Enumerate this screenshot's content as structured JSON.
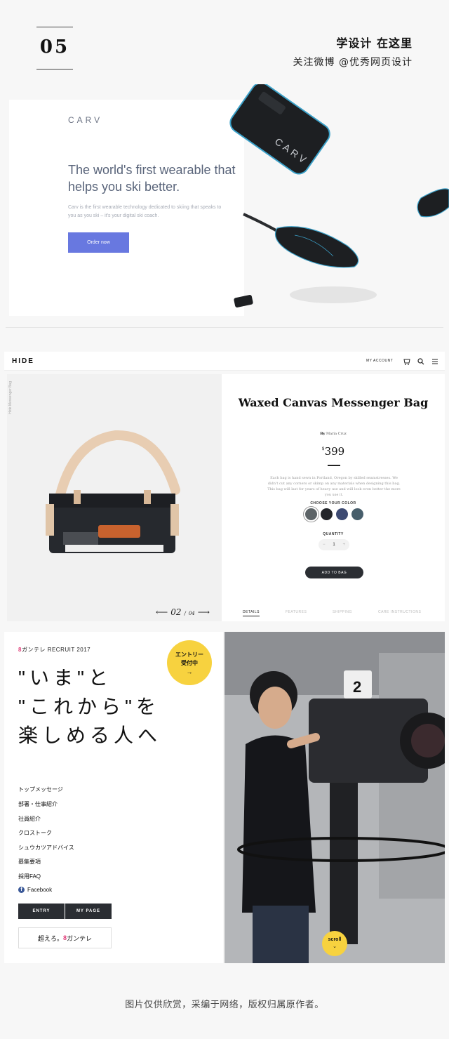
{
  "header": {
    "number": "05",
    "title": "学设计 在这里",
    "subtitle": "关注微博 @优秀网页设计"
  },
  "carv": {
    "logo": "CARV",
    "headline": "The world's first wearable that helps you ski better.",
    "description": "Carv is the first wearable technology dedicated to skiing that speaks to you as you ski – it's your digital ski coach.",
    "cta_label": "Order now",
    "device_text": "CARV",
    "accent_color": "#6878e0"
  },
  "hide": {
    "logo": "HIDE",
    "nav": {
      "account_label": "MY ACCOUNT",
      "icons": [
        "cart-icon",
        "search-icon",
        "menu-icon"
      ]
    },
    "side_label": "Hide Messenger Bag",
    "pager": {
      "current": "02",
      "separator": "/",
      "total": "04"
    },
    "product": {
      "title": "Waxed Canvas Messenger Bag",
      "by_label": "By",
      "author": "Maria Cruz",
      "currency": "$",
      "price": "399",
      "description": "Each bag is hand sewn in Portland, Oregon by skilled seamstresses. We didn't cut any corners or skimp on any materials when designing this bag. This bag will last for years of heavy use and will look even better the more you use it.",
      "color_label": "CHOOSE YOUR COLOR",
      "colors": [
        "#5d6467",
        "#23252a",
        "#3d4a72",
        "#475e6b"
      ],
      "selected_color_index": 0,
      "quantity_label": "QUANTITY",
      "quantity": "1",
      "quantity_minus": "−",
      "quantity_plus": "+",
      "add_label": "ADD TO BAG"
    },
    "tabs": [
      {
        "label": "DETAILS",
        "active": true
      },
      {
        "label": "FEATURES",
        "active": false
      },
      {
        "label": "SHIPPING",
        "active": false
      },
      {
        "label": "CARE INSTRUCTIONS",
        "active": false
      }
    ]
  },
  "kantele": {
    "brand_mark": "8",
    "brand": "ガンテレ",
    "recruit_label": "RECRUIT 2017",
    "headline_lines": [
      "\"いま\"と",
      "\"これから\"を",
      "楽しめる人へ"
    ],
    "entry": {
      "line1": "エントリー",
      "line2": "受付中",
      "arrow": "→"
    },
    "menu": [
      "トップメッセージ",
      "部署・仕事紹介",
      "社員紹介",
      "クロストーク",
      "シュウカツアドバイス",
      "募集要項",
      "採用FAQ",
      "Facebook"
    ],
    "buttons": {
      "entry": "ENTRY",
      "mypage": "MY PAGE"
    },
    "bottom_prefix": "超えろ。",
    "bottom_brand": "ガンテレ",
    "camera_number": "2",
    "scroll_label": "scroll",
    "scroll_icon": "chevron-down-icon",
    "accent_color": "#f7d23f",
    "brand_color": "#e0407b"
  },
  "footer": {
    "note": "图片仅供欣赏，采编于网络，版权归属原作者。"
  }
}
